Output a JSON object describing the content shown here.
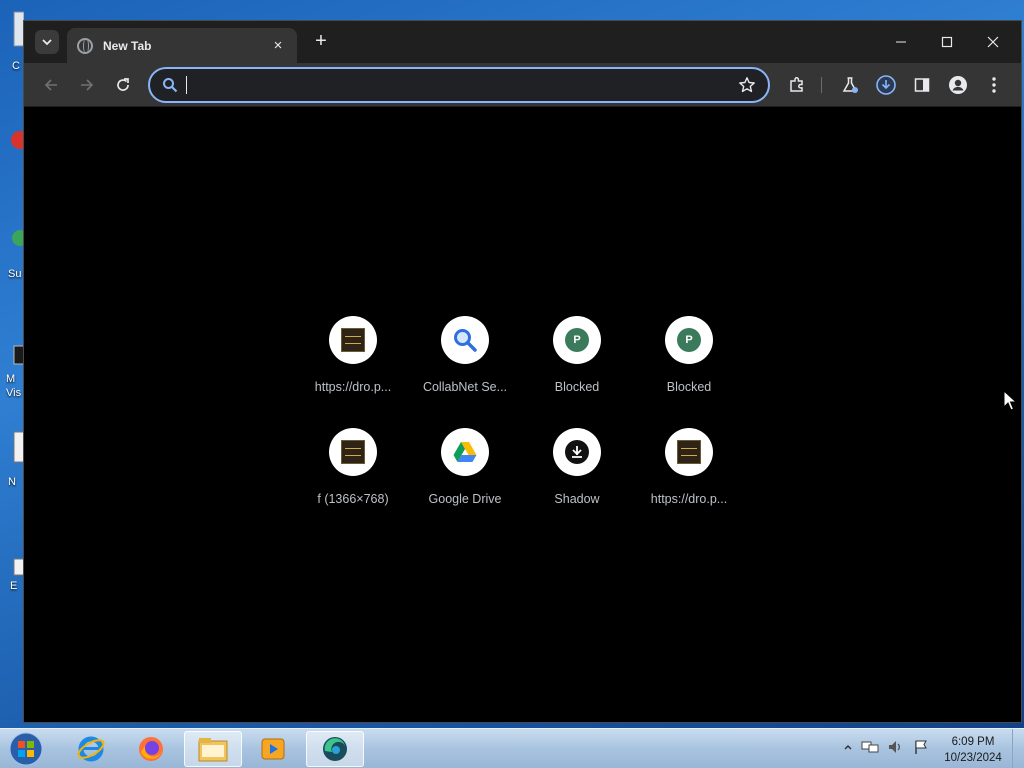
{
  "desktop": {
    "icon_labels": [
      "C",
      "Su",
      "M Vis",
      "N",
      "E"
    ]
  },
  "browser": {
    "tab": {
      "title": "New Tab",
      "close_glyph": "×"
    },
    "new_tab_glyph": "+",
    "window_controls": [
      "minimize",
      "maximize",
      "close"
    ],
    "omnibox": {
      "value": "",
      "placeholder": ""
    },
    "toolbar_icons": [
      "extensions-icon",
      "labs-icon",
      "download-icon",
      "side-panel-icon",
      "profile-icon",
      "menu-icon"
    ],
    "accent_color": "#8ab4f8"
  },
  "shortcuts": [
    {
      "label": "https://dro.p...",
      "icon": "site-thumbnail-icon"
    },
    {
      "label": "CollabNet Se...",
      "icon": "search-icon"
    },
    {
      "label": "Blocked",
      "icon": "p-letter-icon",
      "letter": "P"
    },
    {
      "label": "Blocked",
      "icon": "p-letter-icon",
      "letter": "P"
    },
    {
      "label": "f (1366×768)",
      "icon": "site-thumbnail-icon"
    },
    {
      "label": "Google Drive",
      "icon": "google-drive-icon"
    },
    {
      "label": "Shadow",
      "icon": "shadow-icon"
    },
    {
      "label": "https://dro.p...",
      "icon": "site-thumbnail-icon"
    }
  ],
  "taskbar": {
    "apps": [
      "internet-explorer-icon",
      "firefox-icon",
      "file-explorer-icon",
      "media-player-icon",
      "browser-app-icon"
    ],
    "time": "6:09 PM",
    "date": "10/23/2024"
  }
}
